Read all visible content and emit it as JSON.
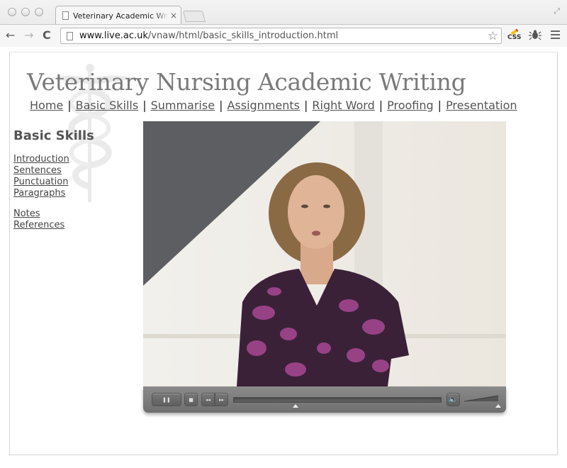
{
  "browser": {
    "tab_title": "Veterinary Academic Writing",
    "tab_close": "×",
    "url_host": "www.live.ac.uk",
    "url_path": "/vnaw/html/basic_skills_introduction.html",
    "icons": {
      "back": "←",
      "forward": "→",
      "reload": "C",
      "bookmark": "☆",
      "css_extension_label": "CSS",
      "bug_extension": "🐞",
      "fullscreen": "⤢"
    }
  },
  "site": {
    "title": "Veterinary Nursing Academic Writing",
    "nav": [
      {
        "label": "Home"
      },
      {
        "label": "Basic Skills"
      },
      {
        "label": "Summarise"
      },
      {
        "label": "Assignments"
      },
      {
        "label": "Right Word"
      },
      {
        "label": "Proofing"
      },
      {
        "label": "Presentation"
      }
    ],
    "nav_separator": "|"
  },
  "sidebar": {
    "heading": "Basic Skills",
    "group1": [
      {
        "label": "Introduction"
      },
      {
        "label": "Sentences"
      },
      {
        "label": "Punctuation"
      },
      {
        "label": "Paragraphs"
      }
    ],
    "group2": [
      {
        "label": "Notes"
      },
      {
        "label": "References"
      }
    ]
  },
  "video_player": {
    "state": "playing",
    "icons": {
      "pause": "❚❚",
      "stop": "■",
      "rewind": "◂◂",
      "fast_forward": "▸▸",
      "volume": "🔈"
    },
    "progress_fraction": 0.3,
    "volume_fraction": 1.0
  }
}
